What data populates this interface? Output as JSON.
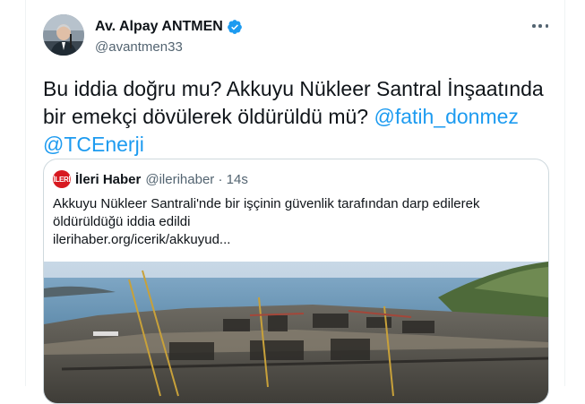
{
  "author": {
    "display_name": "Av. Alpay ANTMEN",
    "handle": "@avantmen33",
    "verified": true
  },
  "tweet": {
    "text_prefix": "Bu iddia doğru mu? Akkuyu Nükleer Santral İnşaatında bir emekçi dövülerek öldürüldü mü?",
    "mention_1": "@fatih_donmez",
    "mention_2": "@TCEnerji"
  },
  "quote": {
    "logo_text": "İLERİ",
    "name": "İleri Haber",
    "meta": "@ilerihaber · 14s",
    "text": "Akkuyu Nükleer Santrali'nde bir işçinin güvenlik tarafından darp edilerek öldürüldüğü iddia edildi",
    "link": "ilerihaber.org/icerik/akkuyud..."
  },
  "icons": {
    "verified": "verified-badge-icon",
    "more": "more-options-icon"
  },
  "colors": {
    "accent": "#1d9bf0",
    "text": "#0f1419",
    "muted": "#536471",
    "border": "#cfd9de"
  }
}
